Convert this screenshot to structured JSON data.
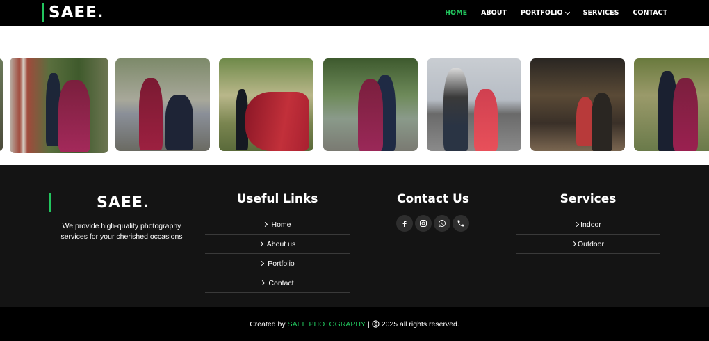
{
  "header": {
    "logo": "SAEE.",
    "nav": [
      {
        "label": "HOME",
        "active": true
      },
      {
        "label": "ABOUT",
        "active": false
      },
      {
        "label": "PORTFOLIO",
        "active": false,
        "dropdown": true
      },
      {
        "label": "SERVICES",
        "active": false
      },
      {
        "label": "CONTACT",
        "active": false
      }
    ]
  },
  "gallery": {
    "photos": [
      "couple-photo",
      "couple-photo",
      "couple-photo",
      "couple-photo",
      "couple-photo",
      "couple-photo",
      "couple-photo"
    ]
  },
  "footer": {
    "logo": "SAEE.",
    "tagline": "We provide high-quality photography services for your cherished occasions",
    "useful_links": {
      "title": "Useful Links",
      "items": [
        "Home",
        "About us",
        "Portfolio",
        "Contact"
      ]
    },
    "contact": {
      "title": "Contact Us",
      "icons": [
        "facebook-icon",
        "instagram-icon",
        "whatsapp-icon",
        "phone-icon"
      ]
    },
    "services": {
      "title": "Services",
      "items": [
        "Indoor",
        "Outdoor"
      ]
    }
  },
  "bottom": {
    "prefix": "Created by",
    "brand": "SAEE PHOTOGRAPHY",
    "suffix": "2025 all rights reserved."
  },
  "colors": {
    "accent": "#22c55e",
    "header_bg": "#000000",
    "footer_bg": "#141414"
  }
}
